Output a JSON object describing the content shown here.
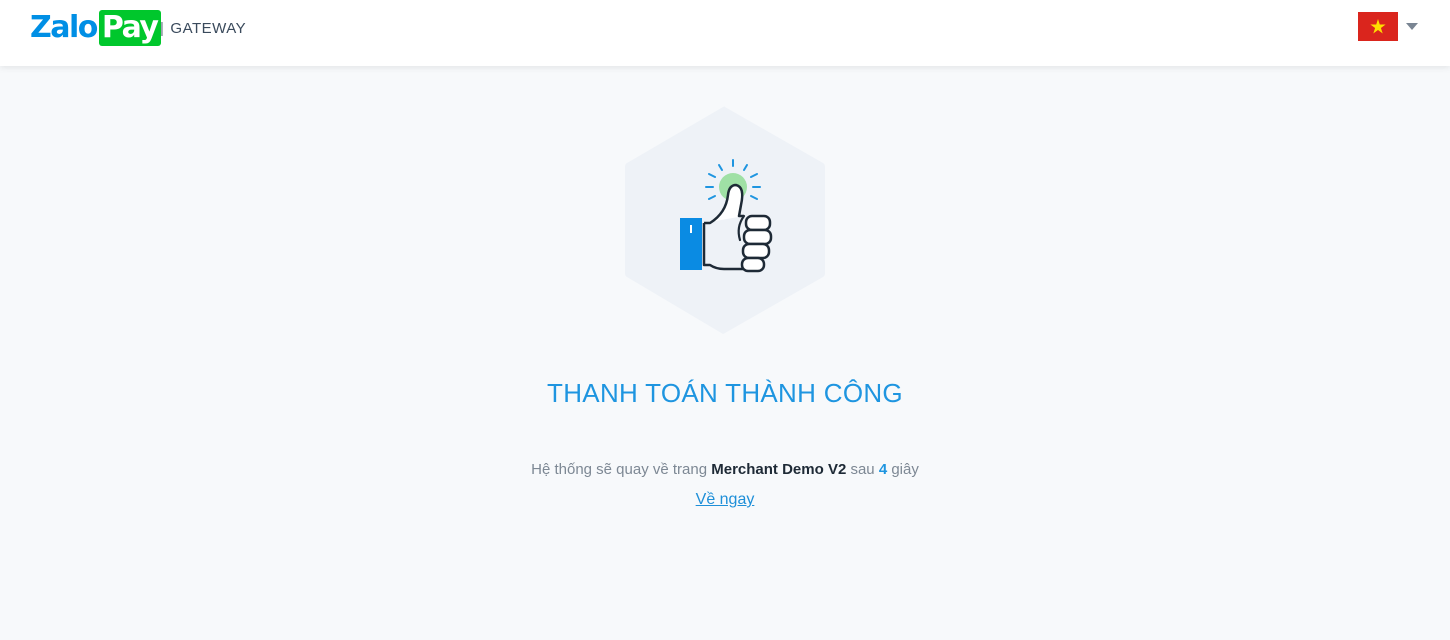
{
  "header": {
    "logo": {
      "part1": "Zalo",
      "part2": "Pay"
    },
    "separator": "|",
    "subtitle": "GATEWAY",
    "language": {
      "flag": "vietnam-flag-icon",
      "dropdown_icon": "caret-down-icon"
    }
  },
  "colors": {
    "brand_blue": "#008fe5",
    "brand_green": "#00c72c",
    "title_blue": "#1e95e0",
    "background": "#f7f9fb"
  },
  "status": {
    "icon": "thumbs-up-icon",
    "title": "THANH TOÁN THÀNH CÔNG",
    "message_prefix": "Hệ thống sẽ quay về trang",
    "merchant_name": "Merchant Demo V2",
    "message_middle": "sau",
    "countdown": "4",
    "message_suffix": "giây",
    "back_link": "Về ngay"
  }
}
